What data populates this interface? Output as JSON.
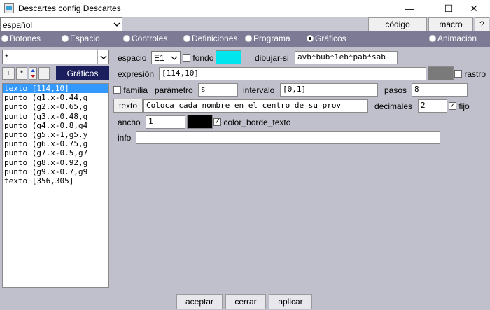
{
  "window": {
    "title": "Descartes config Descartes",
    "minimize": "—",
    "maximize": "☐",
    "close": "✕"
  },
  "toolbar": {
    "language": "español",
    "codigo": "código",
    "macro": "macro",
    "help": "?"
  },
  "tabs": [
    {
      "label": "Botones",
      "selected": false
    },
    {
      "label": "Espacio",
      "selected": false
    },
    {
      "label": "Controles",
      "selected": false
    },
    {
      "label": "Definiciones",
      "selected": false
    },
    {
      "label": "Programa",
      "selected": false
    },
    {
      "label": "Gráficos",
      "selected": true
    },
    {
      "label": "Animación",
      "selected": false
    }
  ],
  "left": {
    "filter": "*",
    "buttons": {
      "add": "+",
      "dup": "*",
      "remove": "−"
    },
    "section": "Gráficos",
    "items": [
      "texto [114,10]",
      "punto (g1.x-0.44,g",
      "punto (g2.x-0.65,g",
      "punto (g3.x-0.48,g",
      "punto (g4.x-0.8,g4",
      "punto (g5.x-1,g5.y",
      "punto (g6.x-0.75,g",
      "punto (g7.x-0.5,g7",
      "punto (g8.x-0.92,g",
      "punto (g9.x-0.7,g9",
      "texto [356,305]"
    ],
    "selected_index": 0
  },
  "form": {
    "espacio_label": "espacio",
    "espacio_value": "E1",
    "fondo_label": "fondo",
    "fondo_color": "#00e5ee",
    "dibujar_label": "dibujar-si",
    "dibujar_value": "avb*bub*leb*pab*sab",
    "expresion_label": "expresión",
    "expresion_value": "[114,10]",
    "rastro_color": "#7a7a7a",
    "rastro_label": "rastro",
    "familia_label": "familia",
    "parametro_label": "parámetro",
    "parametro_value": "s",
    "intervalo_label": "intervalo",
    "intervalo_value": "[0,1]",
    "pasos_label": "pasos",
    "pasos_value": "8",
    "texto_button": "texto",
    "texto_value": "Coloca cada nombre en el centro de su prov",
    "decimales_label": "decimales",
    "decimales_value": "2",
    "fijo_label": "fijo",
    "ancho_label": "ancho",
    "ancho_value": "1",
    "borde_color": "#000000",
    "borde_label": "color_borde_texto",
    "info_label": "info",
    "info_value": ""
  },
  "footer": {
    "aceptar": "aceptar",
    "cerrar": "cerrar",
    "aplicar": "aplicar"
  }
}
